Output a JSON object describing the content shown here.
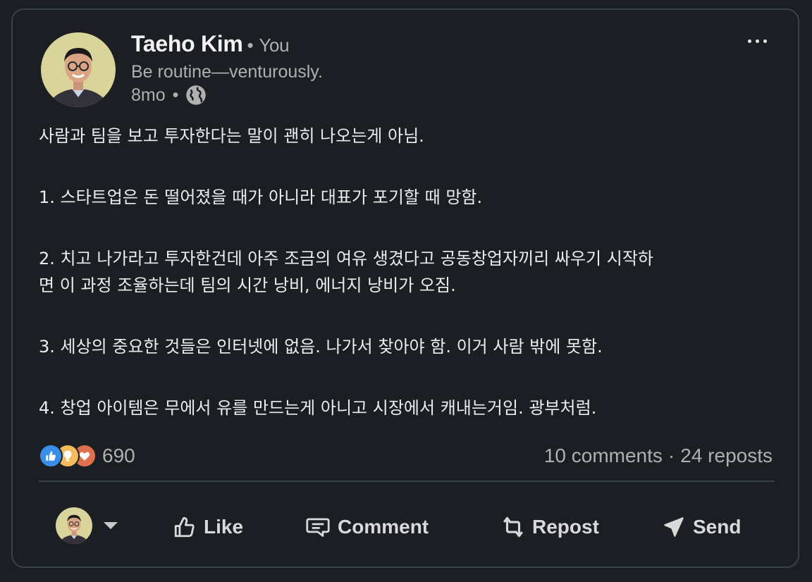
{
  "post": {
    "author": {
      "name": "Taeho Kim",
      "degree": "You",
      "degree_separator": "•",
      "headline": "Be routine—venturously.",
      "time": "8mo",
      "time_separator": "•",
      "visibility_icon": "globe-icon",
      "avatar_icon": "avatar-photo"
    },
    "menu_icon": "more-horizontal-icon",
    "body": {
      "intro": "사람과 팀을 보고 투자한다는 말이 괜히 나오는게 아님.",
      "point1": "1. 스타트업은 돈 떨어졌을 때가 아니라 대표가 포기할 때 망함.",
      "point2_line1": "2. 치고 나가라고 투자한건데 아주 조금의 여유 생겼다고 공동창업자끼리 싸우기 시작하",
      "point2_line2": "면 이 과정 조율하는데 팀의 시간 낭비, 에너지 낭비가 오짐.",
      "point3": "3. 세상의 중요한 것들은 인터넷에 없음. 나가서 찾아야 함. 이거 사람 밖에 못함.",
      "point4": "4. 창업 아이템은 무에서 유를 만드는게 아니고 시장에서 캐내는거임. 광부처럼."
    },
    "stats": {
      "reaction_icons": [
        "like-reaction-icon",
        "insightful-reaction-icon",
        "love-reaction-icon"
      ],
      "reaction_count": "690",
      "comments": "10 comments",
      "separator": "·",
      "reposts": "24 reposts"
    },
    "actions": {
      "like": "Like",
      "comment": "Comment",
      "repost": "Repost",
      "send": "Send"
    }
  },
  "colors": {
    "background": "#1b1f23",
    "border": "#38434f",
    "text_primary": "#ececec",
    "text_secondary": "#b0b0b0",
    "like_blue": "#378fe9",
    "insight_yellow": "#f5bb5c",
    "love_red": "#df704d"
  }
}
